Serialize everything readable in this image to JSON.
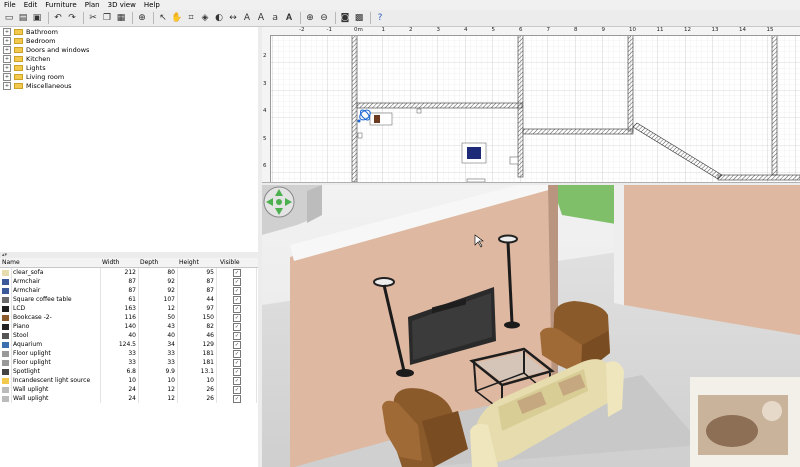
{
  "menu": [
    "File",
    "Edit",
    "Furniture",
    "Plan",
    "3D view",
    "Help"
  ],
  "catalog": [
    "Bathroom",
    "Bedroom",
    "Doors and windows",
    "Kitchen",
    "Lights",
    "Living room",
    "Miscellaneous"
  ],
  "furniture_table": {
    "columns": [
      "Name",
      "Width",
      "Depth",
      "Height",
      "Visible"
    ],
    "rows": [
      {
        "name": "clear_sofa",
        "width": "212",
        "depth": "80",
        "height": "95"
      },
      {
        "name": "Armchair",
        "width": "87",
        "depth": "92",
        "height": "87"
      },
      {
        "name": "Armchair",
        "width": "87",
        "depth": "92",
        "height": "87"
      },
      {
        "name": "Square coffee table",
        "width": "61",
        "depth": "107",
        "height": "44"
      },
      {
        "name": "LCD",
        "width": "163",
        "depth": "12",
        "height": "97"
      },
      {
        "name": "Bookcase -2-",
        "width": "116",
        "depth": "50",
        "height": "150"
      },
      {
        "name": "Piano",
        "width": "140",
        "depth": "43",
        "height": "82"
      },
      {
        "name": "Stool",
        "width": "40",
        "depth": "40",
        "height": "46"
      },
      {
        "name": "Aquarium",
        "width": "124.5",
        "depth": "34",
        "height": "129"
      },
      {
        "name": "Floor uplight",
        "width": "33",
        "depth": "33",
        "height": "181"
      },
      {
        "name": "Floor uplight",
        "width": "33",
        "depth": "33",
        "height": "181"
      },
      {
        "name": "Spotlight",
        "width": "6.8",
        "depth": "9.9",
        "height": "13.1"
      },
      {
        "name": "Incandescent light source",
        "width": "10",
        "depth": "10",
        "height": "10"
      },
      {
        "name": "Wall uplight",
        "width": "24",
        "depth": "12",
        "height": "26"
      },
      {
        "name": "Wall uplight",
        "width": "24",
        "depth": "12",
        "height": "26"
      }
    ]
  },
  "plan": {
    "ruler_top": [
      "-2",
      "-1",
      "0m",
      "1",
      "2",
      "3",
      "4",
      "5",
      "6",
      "7",
      "8",
      "9",
      "10",
      "11",
      "12",
      "13",
      "14",
      "15"
    ],
    "ruler_left": [
      "2",
      "3",
      "4",
      "5",
      "6"
    ]
  },
  "colors": {
    "wall": "#deb8a0",
    "floor": "#d5d5d5",
    "grass": "#7fbf6a",
    "sofa": "#e6dcae",
    "armchair": "#8b5a2b"
  },
  "icons": [
    "new-icon",
    "open-icon",
    "save-icon",
    "cut-icon",
    "copy-icon",
    "paste-icon",
    "undo-icon",
    "redo-icon",
    "add-furniture-icon",
    "select-icon",
    "pan-icon",
    "create-walls-icon",
    "create-rooms-icon",
    "create-dimensions-icon",
    "add-text-icon",
    "zoom-in-icon",
    "zoom-out-icon",
    "photo-icon",
    "video-icon",
    "help-icon"
  ]
}
